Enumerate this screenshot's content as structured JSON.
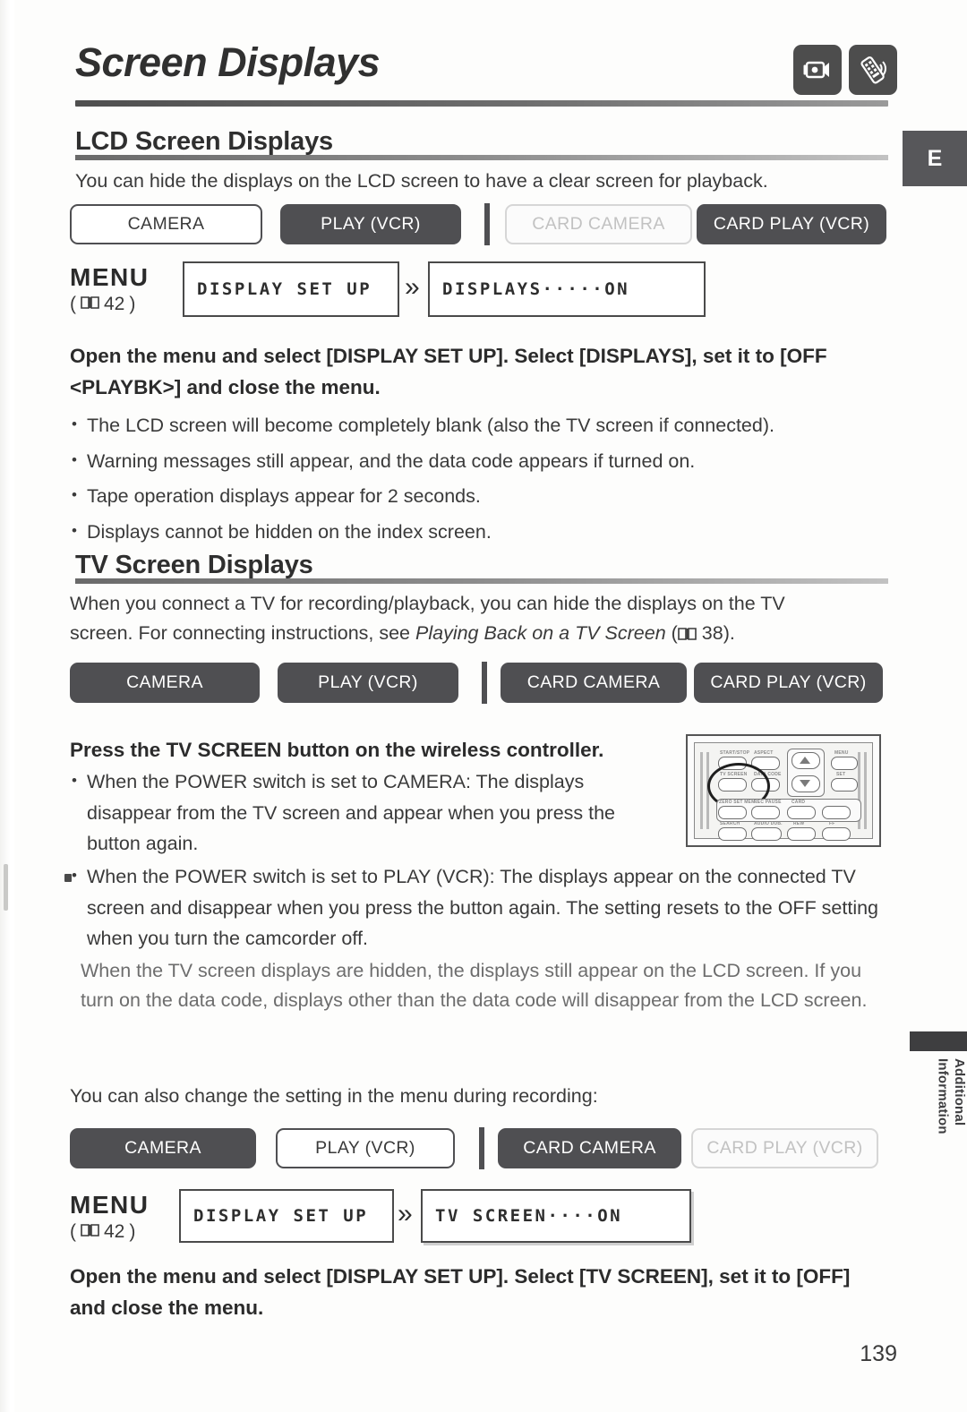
{
  "header": {
    "title": "Screen Displays",
    "icons": [
      {
        "name": "lcd-screen-icon",
        "label": "LCD screen"
      },
      {
        "name": "wireless-controller-icon",
        "label": "wireless controller"
      }
    ]
  },
  "side_tabs": {
    "language_tab": "E",
    "section_tab": "Additional\nInformation"
  },
  "sections": [
    {
      "heading": "LCD Screen Displays",
      "intro": "You can hide the displays on the LCD screen to have a clear screen for playback.",
      "modes": [
        {
          "label": "CAMERA",
          "state": "off"
        },
        {
          "label": "PLAY (VCR)",
          "state": "on"
        },
        {
          "label": "CARD CAMERA",
          "state": "dim"
        },
        {
          "label": "CARD PLAY (VCR)",
          "state": "on"
        }
      ],
      "menu": {
        "word": "MENU",
        "ref": "42",
        "left_box": "DISPLAY SET UP",
        "arrow": "»",
        "right_box": "DISPLAYS·····ON"
      },
      "step": "Open the menu and select [DISPLAY SET UP]. Select [DISPLAYS], set it to [OFF <PLAYBK>] and close the menu.",
      "bullets": [
        "The LCD screen will become completely blank (also the TV screen if connected).",
        "Warning messages still appear, and the data code appears if turned on.",
        "Tape operation displays appear for 2 seconds.",
        "Displays cannot be hidden on the index screen."
      ]
    },
    {
      "heading": "TV Screen Displays",
      "intro_line1": "When you connect a TV for recording/playback, you can hide the displays on the TV",
      "intro_line2_a": "screen. For connecting instructions, see ",
      "intro_line2_italic": "Playing Back on a TV Screen",
      "intro_line2_b": " (",
      "intro_page_ref": "38",
      "intro_line2_c": ").",
      "modes": [
        {
          "label": "CAMERA",
          "state": "on"
        },
        {
          "label": "PLAY (VCR)",
          "state": "on"
        },
        {
          "label": "CARD CAMERA",
          "state": "on"
        },
        {
          "label": "CARD PLAY (VCR)",
          "state": "on"
        }
      ],
      "step": "Press the TV SCREEN button on the wireless controller.",
      "bullet_camera": "When the POWER switch is set to CAMERA: The displays disappear from the TV screen and appear when you press the button again.",
      "bullet_play": "When the POWER switch is set to PLAY (VCR): The displays appear on the connected TV screen and disappear when you press the button again. The setting resets to the OFF setting when you turn the camcorder off.",
      "bullet_play_cont": "When the TV screen displays are hidden, the displays still appear on the LCD screen. If you turn on the data code, displays other than the data code will disappear from the LCD screen.",
      "menu_intro": "You can also change the setting in the menu during recording:",
      "modes2": [
        {
          "label": "CAMERA",
          "state": "on"
        },
        {
          "label": "PLAY (VCR)",
          "state": "off"
        },
        {
          "label": "CARD CAMERA",
          "state": "on"
        },
        {
          "label": "CARD PLAY (VCR)",
          "state": "dim"
        }
      ],
      "menu": {
        "word": "MENU",
        "ref": "42",
        "left_box": "DISPLAY SET UP",
        "arrow": "»",
        "right_box": "TV SCREEN····ON"
      },
      "step2": "Open the menu and select [DISPLAY SET UP]. Select [TV SCREEN], set it to [OFF] and close the menu."
    }
  ],
  "remote": {
    "caption_name": "wireless-controller-illustration",
    "highlighted_button": "TV SCREEN",
    "buttons": [
      "START/STOP",
      "ASPECT",
      "MENU",
      "TV SCREEN",
      "DATA CODE",
      "SET",
      "ZERO SET MEM.",
      "REC PAUSE",
      "CARD",
      "SEARCH",
      "AUDIO DUB.",
      "REW",
      "FF"
    ]
  },
  "page_number": "139"
}
